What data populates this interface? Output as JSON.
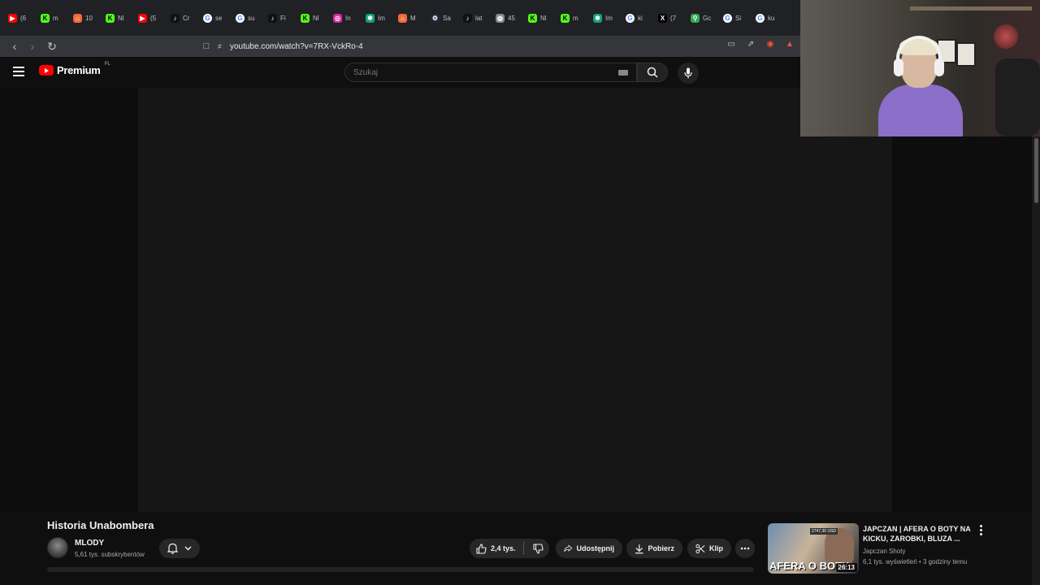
{
  "browser": {
    "tabs": [
      {
        "label": "(6",
        "icon": "youtube-icon",
        "color": "#ff0000"
      },
      {
        "label": "m",
        "icon": "kick-icon",
        "color": "#53fc18"
      },
      {
        "label": "10",
        "icon": "home-icon",
        "color": "#f06a35"
      },
      {
        "label": "Nl",
        "icon": "kick-icon",
        "color": "#53fc18"
      },
      {
        "label": "(5",
        "icon": "youtube-icon",
        "color": "#ff0000"
      },
      {
        "label": "Cr",
        "icon": "tiktok-icon",
        "color": "#111111"
      },
      {
        "label": "se",
        "icon": "google-icon",
        "color": "#ffffff"
      },
      {
        "label": "su",
        "icon": "google-icon",
        "color": "#ffffff"
      },
      {
        "label": "Fi",
        "icon": "tiktok-icon",
        "color": "#111111"
      },
      {
        "label": "Nl",
        "icon": "kick-icon",
        "color": "#53fc18"
      },
      {
        "label": "In",
        "icon": "instagram-icon",
        "color": "#d6249f"
      },
      {
        "label": "Im",
        "icon": "chatgpt-icon",
        "color": "#10a37f"
      },
      {
        "label": "M",
        "icon": "home-icon",
        "color": "#f06a35"
      },
      {
        "label": "Sa",
        "icon": "steam-icon",
        "color": "#1b2838"
      },
      {
        "label": "lat",
        "icon": "tiktok-icon",
        "color": "#111111"
      },
      {
        "label": "45",
        "icon": "globe-icon",
        "color": "#888888"
      },
      {
        "label": "Nl",
        "icon": "kick-icon",
        "color": "#53fc18"
      },
      {
        "label": "m",
        "icon": "kick-icon",
        "color": "#53fc18"
      },
      {
        "label": "Im",
        "icon": "chatgpt-icon",
        "color": "#10a37f"
      },
      {
        "label": "ki",
        "icon": "google-icon",
        "color": "#ffffff"
      },
      {
        "label": "(7",
        "icon": "x-icon",
        "color": "#000000"
      },
      {
        "label": "Gc",
        "icon": "maps-icon",
        "color": "#34a853"
      },
      {
        "label": "Si",
        "icon": "google-icon",
        "color": "#ffffff"
      },
      {
        "label": "ku",
        "icon": "google-icon",
        "color": "#ffffff"
      }
    ],
    "url": "youtube.com/watch?v=7RX-VckRo-4"
  },
  "youtube": {
    "logo_text": "Premium",
    "country_code": "PL",
    "search_placeholder": "Szukaj"
  },
  "video": {
    "title": "Historia Unabombera",
    "channel_name": "MLODY",
    "subscribers": "5,61 tys. subskrybentów",
    "likes": "2,4 tys.",
    "share_label": "Udostępnij",
    "download_label": "Pobierz",
    "clip_label": "Klip"
  },
  "recommendation": {
    "title": "JAPCZAN | AFERA O BOTY NA KICKU, ZAROBKI, BLUZA ...",
    "channel": "Japczan Shoty",
    "meta": "6,1 tys. wyświetleń • 3 godziny temu",
    "duration": "26:13",
    "thumb_text": "AFERA O BOTY",
    "thumb_price": "2747,30 USD"
  }
}
